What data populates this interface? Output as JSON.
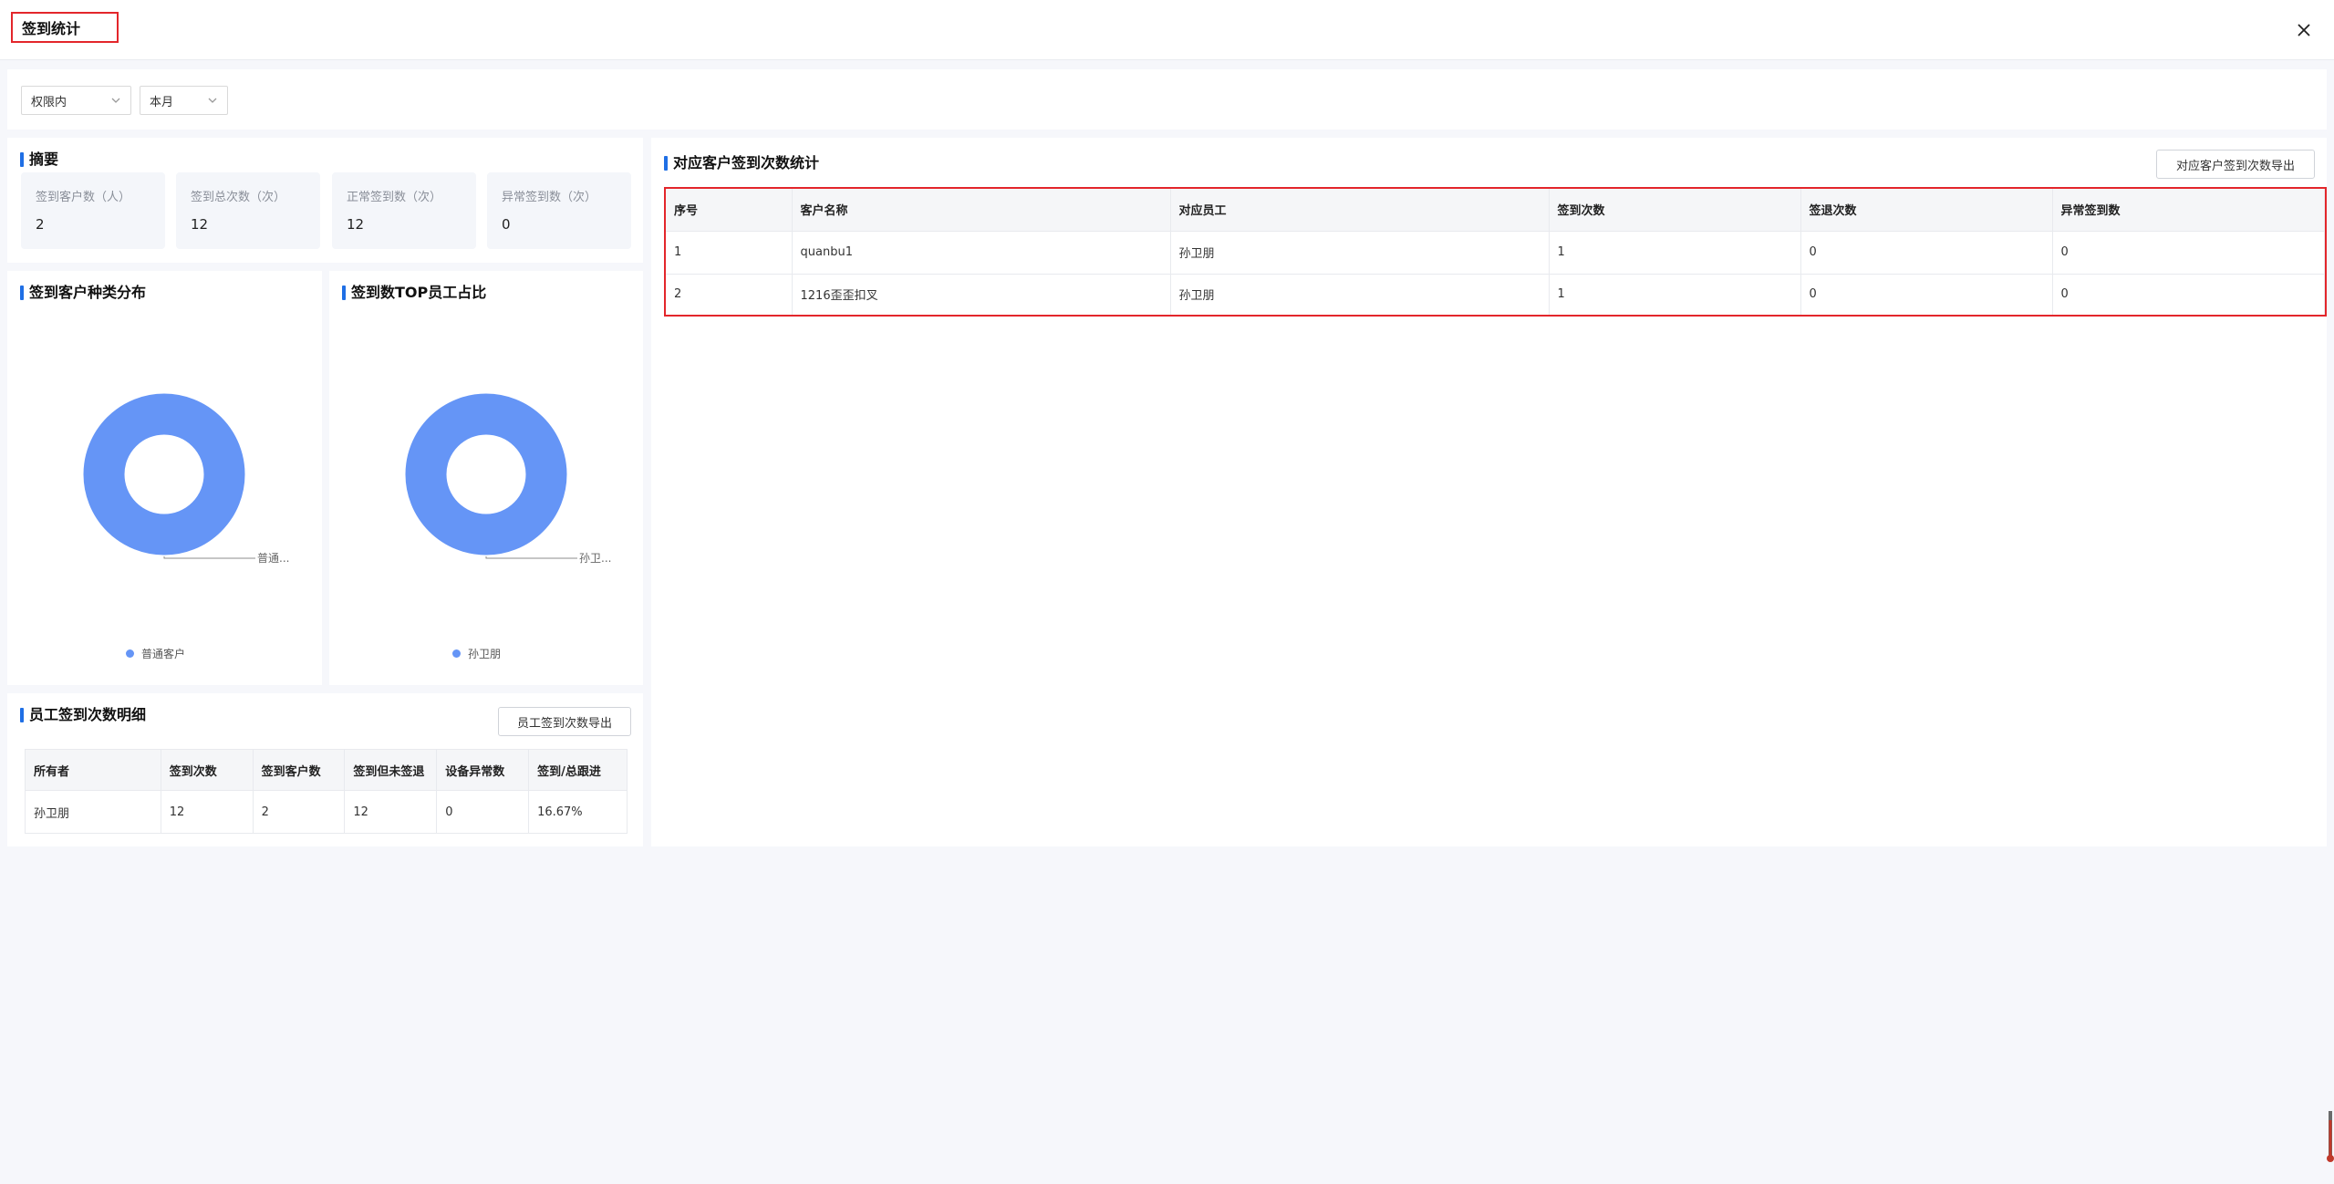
{
  "header": {
    "title": "签到统计"
  },
  "filters": {
    "scope": "权限内",
    "period": "本月"
  },
  "summary": {
    "title": "摘要",
    "items": [
      {
        "label": "签到客户数（人）",
        "value": "2"
      },
      {
        "label": "签到总次数（次）",
        "value": "12"
      },
      {
        "label": "正常签到数（次）",
        "value": "12"
      },
      {
        "label": "异常签到数（次）",
        "value": "0"
      }
    ]
  },
  "customer_type_chart": {
    "title": "签到客户种类分布",
    "slice_label": "普通...",
    "legend": "普通客户",
    "color": "#6595f6"
  },
  "top_staff_chart": {
    "title": "签到数TOP员工占比",
    "slice_label": "孙卫...",
    "legend": "孙卫朋",
    "color": "#6595f6"
  },
  "chart_data": [
    {
      "type": "pie",
      "title": "签到客户种类分布",
      "categories": [
        "普通客户"
      ],
      "values": [
        100
      ],
      "legend_position": "bottom"
    },
    {
      "type": "pie",
      "title": "签到数TOP员工占比",
      "categories": [
        "孙卫朋"
      ],
      "values": [
        100
      ],
      "legend_position": "bottom"
    }
  ],
  "staff_detail": {
    "title": "员工签到次数明细",
    "export_label": "员工签到次数导出",
    "columns": [
      "所有者",
      "签到次数",
      "签到客户数",
      "签到但未签退",
      "设备异常数",
      "签到/总跟进"
    ],
    "rows": [
      [
        "孙卫朋",
        "12",
        "2",
        "12",
        "0",
        "16.67%"
      ]
    ]
  },
  "customer_stats": {
    "title": "对应客户签到次数统计",
    "export_label": "对应客户签到次数导出",
    "columns": [
      "序号",
      "客户名称",
      "对应员工",
      "签到次数",
      "签退次数",
      "异常签到数"
    ],
    "rows": [
      [
        "1",
        "quanbu1",
        "孙卫朋",
        "1",
        "0",
        "0"
      ],
      [
        "2",
        "1216歪歪扣叉",
        "孙卫朋",
        "1",
        "0",
        "0"
      ]
    ]
  },
  "colors": {
    "accent": "#1f6fe5",
    "highlight": "#e3262b",
    "donut": "#6595f6"
  }
}
